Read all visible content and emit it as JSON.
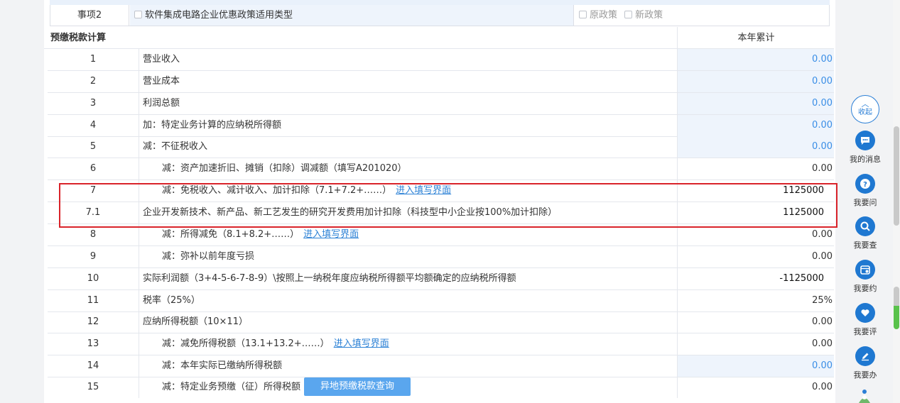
{
  "item2": {
    "label": "事项2",
    "option": "软件集成电路企业优惠政策适用类型",
    "old_policy": "原政策",
    "new_policy": "新政策"
  },
  "section": {
    "title": "预缴税款计算",
    "column_header": "本年累计"
  },
  "link_text": "进入填写界面",
  "rows": [
    {
      "num": "1",
      "desc": "营业收入",
      "value": "0.00"
    },
    {
      "num": "2",
      "desc": "营业成本",
      "value": "0.00"
    },
    {
      "num": "3",
      "desc": "利润总额",
      "value": "0.00"
    },
    {
      "num": "4",
      "desc": "加：特定业务计算的应纳税所得额",
      "value": "0.00"
    },
    {
      "num": "5",
      "desc": "减：不征税收入",
      "value": "0.00"
    },
    {
      "num": "6",
      "desc": "减：资产加速折旧、摊销（扣除）调减额（填写A201020）",
      "value": "0.00"
    },
    {
      "num": "7",
      "desc": "减：免税收入、减计收入、加计扣除（7.1+7.2+……）",
      "value": "1125000"
    },
    {
      "num": "7.1",
      "desc": "企业开发新技术、新产品、新工艺发生的研究开发费用加计扣除（科技型中小企业按100%加计扣除）",
      "value": "1125000"
    },
    {
      "num": "8",
      "desc": "减：所得减免（8.1+8.2+……）",
      "value": "0.00"
    },
    {
      "num": "9",
      "desc": "减：弥补以前年度亏损",
      "value": "0.00"
    },
    {
      "num": "10",
      "desc": "实际利润额（3+4-5-6-7-8-9）\\按照上一纳税年度应纳税所得额平均额确定的应纳税所得额",
      "value": "-1125000"
    },
    {
      "num": "11",
      "desc": "税率（25%）",
      "value": "25%"
    },
    {
      "num": "12",
      "desc": "应纳所得税额（10×11）",
      "value": "0.00"
    },
    {
      "num": "13",
      "desc": "减：减免所得税额（13.1+13.2+……）",
      "value": "0.00"
    },
    {
      "num": "14",
      "desc": "减：本年实际已缴纳所得税额",
      "value": "0.00"
    },
    {
      "num": "15",
      "desc": "减：特定业务预缴（征）所得税额",
      "value": "0.00"
    }
  ],
  "query_button": "异地预缴税款查询",
  "sidebar": {
    "collapse": "收起",
    "items": [
      {
        "label": "我的消息",
        "icon": "message-icon"
      },
      {
        "label": "我要问",
        "icon": "question-icon"
      },
      {
        "label": "我要查",
        "icon": "search-icon"
      },
      {
        "label": "我要约",
        "icon": "calendar-icon"
      },
      {
        "label": "我要评",
        "icon": "heart-icon"
      },
      {
        "label": "我要办",
        "icon": "edit-icon"
      }
    ]
  },
  "colors": {
    "accent": "#1f78d1",
    "highlight_border": "#d9232a",
    "readonly_value": "#3a8ee6",
    "readonly_bg": "#eef4fc"
  }
}
